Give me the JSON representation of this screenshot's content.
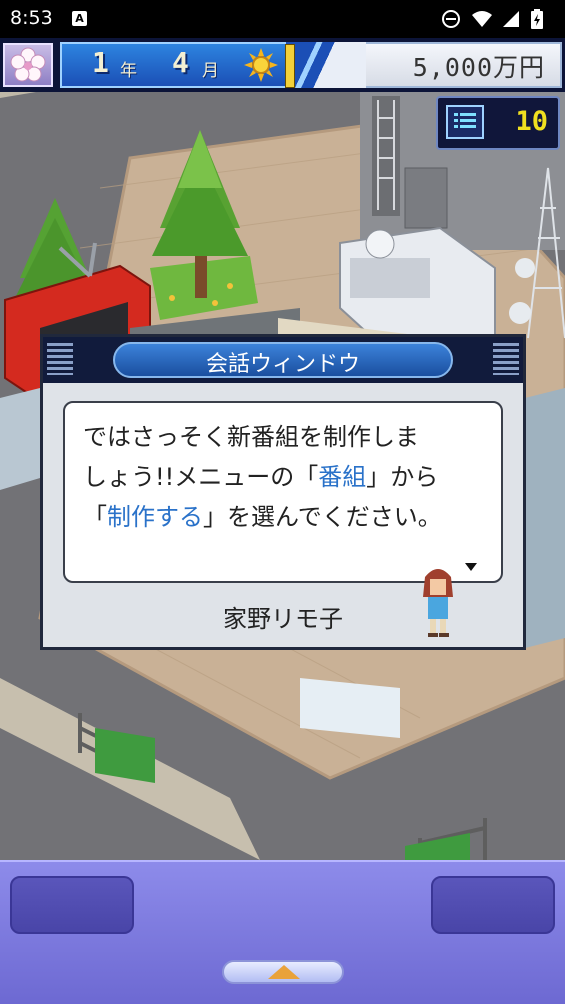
{
  "status_bar": {
    "time": "8:53",
    "notification_badge": "A",
    "icons": [
      "do-not-disturb-icon",
      "wifi-icon",
      "signal-icon",
      "battery-icon"
    ]
  },
  "hud": {
    "season_icon": "cherry-blossom-icon",
    "year": "1",
    "year_unit": "年",
    "month": "4",
    "month_unit": "月",
    "weather_icon": "sun-icon",
    "money": "5,000万円"
  },
  "counter": {
    "icon": "monitor-icon",
    "value": "10"
  },
  "dialog": {
    "title": "会話ウィンドウ",
    "line1": "ではさっそく新番組を制作しま",
    "line2_a": "しょう!!メニューの「",
    "line2_hl": "番組",
    "line2_b": "」から",
    "line3_a": "「",
    "line3_hl": "制作する",
    "line3_b": "」を選んでください。",
    "speaker": "家野リモ子",
    "highlight_color": "#2a72c9"
  },
  "bottom": {
    "up_icon": "up-arrow-icon"
  }
}
